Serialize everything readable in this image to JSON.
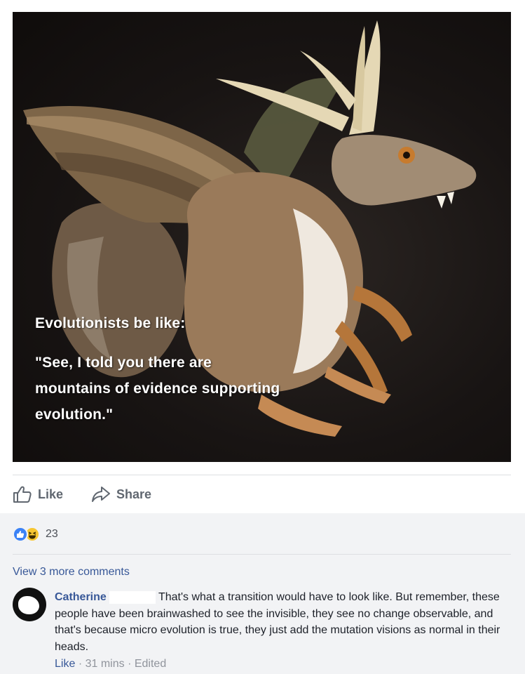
{
  "post": {
    "image_text": {
      "line1": "Evolutionists be like:",
      "line2": "\"See, I told you there are",
      "line3": "mountains of evidence supporting",
      "line4": "evolution.\""
    },
    "actions": {
      "like_label": "Like",
      "share_label": "Share"
    },
    "reactions": {
      "count": "23",
      "types": [
        "like-icon",
        "haha-icon"
      ]
    }
  },
  "comments": {
    "view_more": "View 3 more comments",
    "items": [
      {
        "author": "Catherine",
        "text": "That's what a transition would have to look like. But remember, these people have been brainwashed to see the invisible, they see no change observable, and that's because micro evolution is true, they just add the mutation visions as normal in their heads.",
        "like_label": "Like",
        "sep": "·",
        "time": "31 mins",
        "edited": "Edited"
      }
    ]
  },
  "colors": {
    "link": "#385898",
    "muted": "#606770",
    "comment_bg": "#f2f3f5"
  }
}
